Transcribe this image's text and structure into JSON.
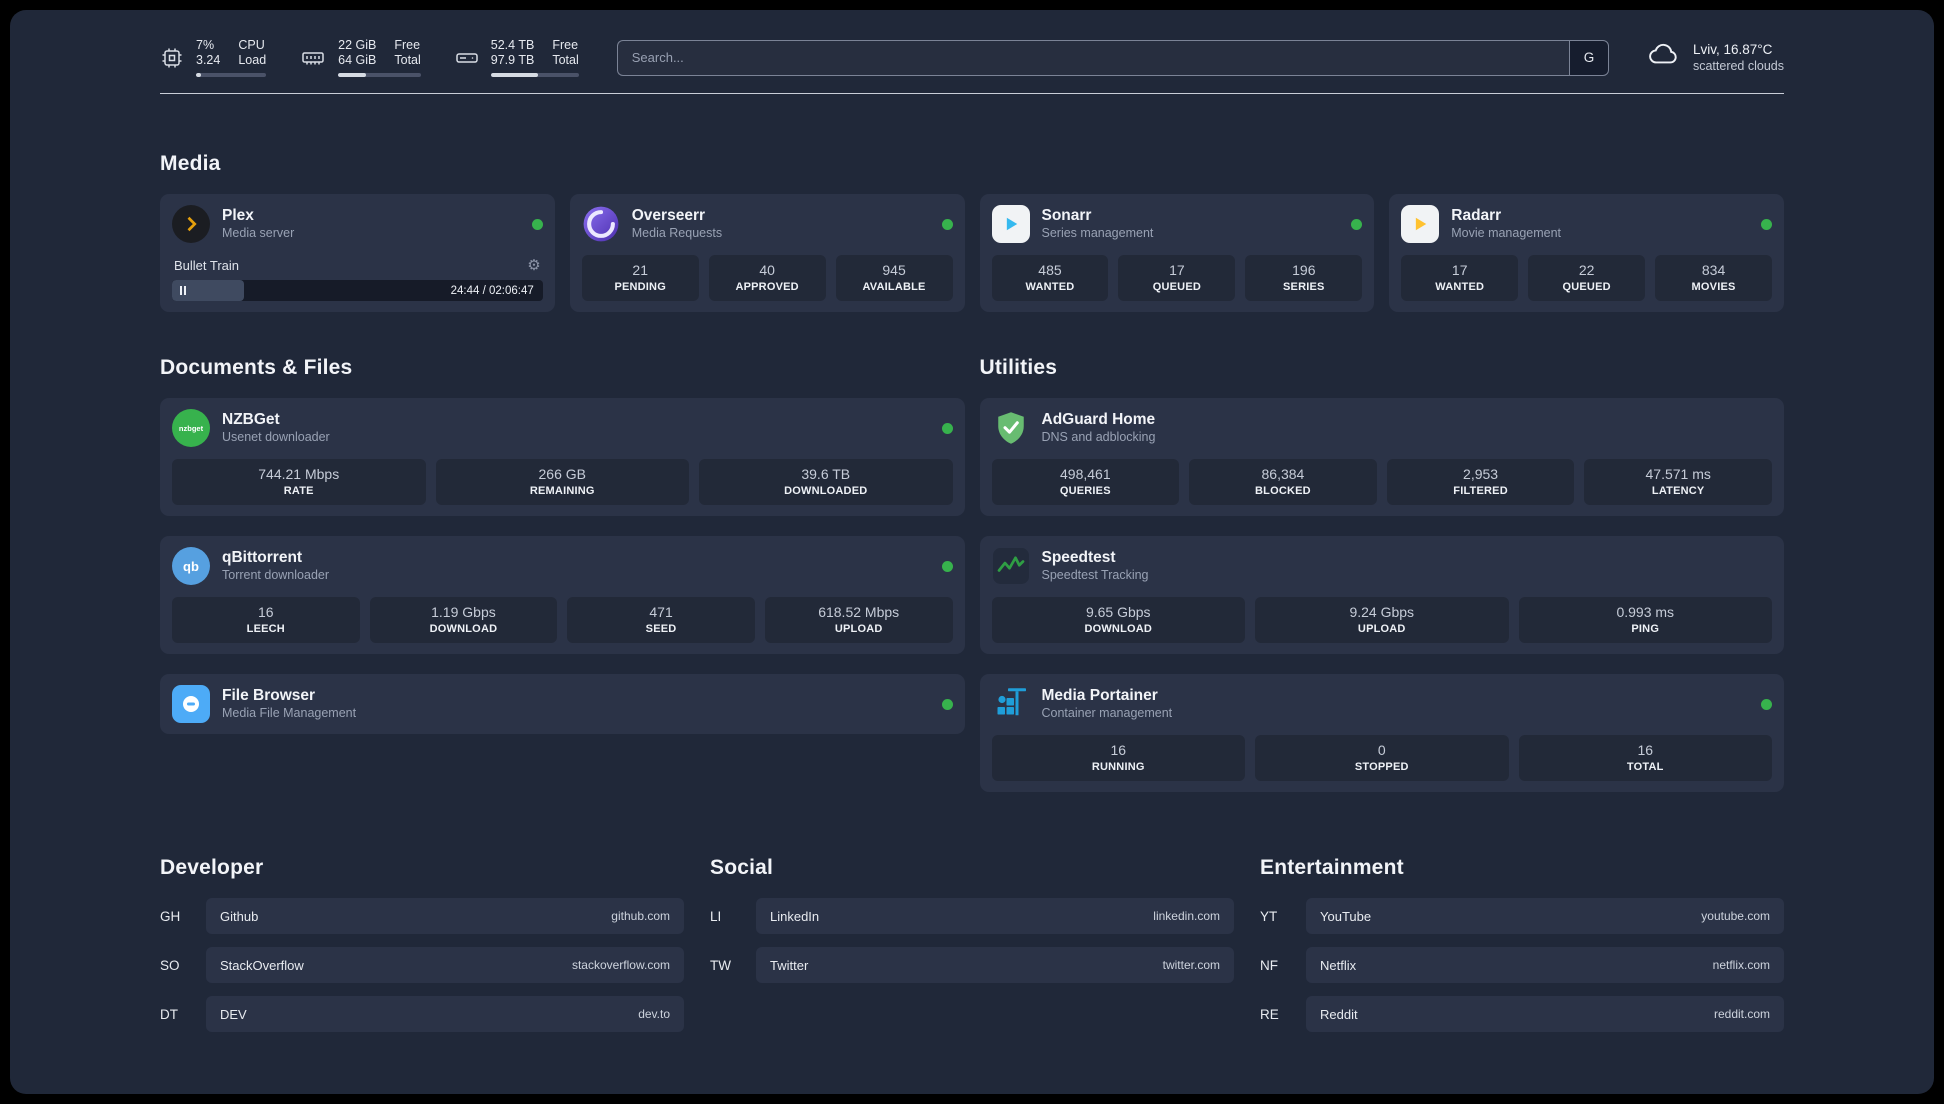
{
  "colors": {
    "status_green": "#37b24d",
    "panel_bg": "#202839",
    "card_bg": "#2b3347",
    "plex_accent": "#e5a00d",
    "sonarr_accent": "#35b9ef",
    "radarr_accent": "#ffc230",
    "nzbget_green": "#37b24d",
    "qbittorrent_blue": "#56a0e0",
    "adguard_green": "#68bc71",
    "speedtest_green": "#2f9e44",
    "portainer_blue": "#1f9ed9",
    "overseerr_purple": "#6741d9",
    "filebrowser_blue": "#4dabf7"
  },
  "topbar": {
    "cpu": {
      "value_top": "7%",
      "label_top": "CPU",
      "value_bottom": "3.24",
      "label_bottom": "Load",
      "progress": 7
    },
    "ram": {
      "value_top": "22 GiB",
      "label_top": "Free",
      "value_bottom": "64 GiB",
      "label_bottom": "Total",
      "progress": 34
    },
    "disk": {
      "value_top": "52.4 TB",
      "label_top": "Free",
      "value_bottom": "97.9 TB",
      "label_bottom": "Total",
      "progress": 54
    },
    "search": {
      "placeholder": "Search...",
      "engine_label": "G"
    },
    "weather": {
      "location": "Lviv, 16.87°C",
      "condition": "scattered clouds"
    }
  },
  "media": {
    "title": "Media",
    "plex": {
      "name": "Plex",
      "subtitle": "Media server",
      "now_playing": "Bullet Train",
      "time": "24:44 / 02:06:47",
      "progress": 19.5
    },
    "overseerr": {
      "name": "Overseerr",
      "subtitle": "Media Requests",
      "stats": [
        {
          "value": "21",
          "label": "PENDING"
        },
        {
          "value": "40",
          "label": "APPROVED"
        },
        {
          "value": "945",
          "label": "AVAILABLE"
        }
      ]
    },
    "sonarr": {
      "name": "Sonarr",
      "subtitle": "Series management",
      "stats": [
        {
          "value": "485",
          "label": "WANTED"
        },
        {
          "value": "17",
          "label": "QUEUED"
        },
        {
          "value": "196",
          "label": "SERIES"
        }
      ]
    },
    "radarr": {
      "name": "Radarr",
      "subtitle": "Movie management",
      "stats": [
        {
          "value": "17",
          "label": "WANTED"
        },
        {
          "value": "22",
          "label": "QUEUED"
        },
        {
          "value": "834",
          "label": "MOVIES"
        }
      ]
    }
  },
  "documents": {
    "title": "Documents & Files",
    "nzbget": {
      "name": "NZBGet",
      "subtitle": "Usenet downloader",
      "icon_text": "nzbget",
      "stats": [
        {
          "value": "744.21 Mbps",
          "label": "RATE"
        },
        {
          "value": "266 GB",
          "label": "REMAINING"
        },
        {
          "value": "39.6 TB",
          "label": "DOWNLOADED"
        }
      ]
    },
    "qbittorrent": {
      "name": "qBittorrent",
      "subtitle": "Torrent downloader",
      "icon_text": "qb",
      "stats": [
        {
          "value": "16",
          "label": "LEECH"
        },
        {
          "value": "1.19 Gbps",
          "label": "DOWNLOAD"
        },
        {
          "value": "471",
          "label": "SEED"
        },
        {
          "value": "618.52 Mbps",
          "label": "UPLOAD"
        }
      ]
    },
    "filebrowser": {
      "name": "File Browser",
      "subtitle": "Media File Management"
    }
  },
  "utilities": {
    "title": "Utilities",
    "adguard": {
      "name": "AdGuard Home",
      "subtitle": "DNS and adblocking",
      "stats": [
        {
          "value": "498,461",
          "label": "QUERIES"
        },
        {
          "value": "86,384",
          "label": "BLOCKED"
        },
        {
          "value": "2,953",
          "label": "FILTERED"
        },
        {
          "value": "47.571 ms",
          "label": "LATENCY"
        }
      ]
    },
    "speedtest": {
      "name": "Speedtest",
      "subtitle": "Speedtest Tracking",
      "stats": [
        {
          "value": "9.65 Gbps",
          "label": "DOWNLOAD"
        },
        {
          "value": "9.24 Gbps",
          "label": "UPLOAD"
        },
        {
          "value": "0.993 ms",
          "label": "PING"
        }
      ]
    },
    "portainer": {
      "name": "Media Portainer",
      "subtitle": "Container management",
      "stats": [
        {
          "value": "16",
          "label": "RUNNING"
        },
        {
          "value": "0",
          "label": "STOPPED"
        },
        {
          "value": "16",
          "label": "TOTAL"
        }
      ]
    }
  },
  "bookmarks": {
    "developer": {
      "title": "Developer",
      "items": [
        {
          "abbr": "GH",
          "name": "Github",
          "url": "github.com"
        },
        {
          "abbr": "SO",
          "name": "StackOverflow",
          "url": "stackoverflow.com"
        },
        {
          "abbr": "DT",
          "name": "DEV",
          "url": "dev.to"
        }
      ]
    },
    "social": {
      "title": "Social",
      "items": [
        {
          "abbr": "LI",
          "name": "LinkedIn",
          "url": "linkedin.com"
        },
        {
          "abbr": "TW",
          "name": "Twitter",
          "url": "twitter.com"
        }
      ]
    },
    "entertainment": {
      "title": "Entertainment",
      "items": [
        {
          "abbr": "YT",
          "name": "YouTube",
          "url": "youtube.com"
        },
        {
          "abbr": "NF",
          "name": "Netflix",
          "url": "netflix.com"
        },
        {
          "abbr": "RE",
          "name": "Reddit",
          "url": "reddit.com"
        }
      ]
    }
  }
}
